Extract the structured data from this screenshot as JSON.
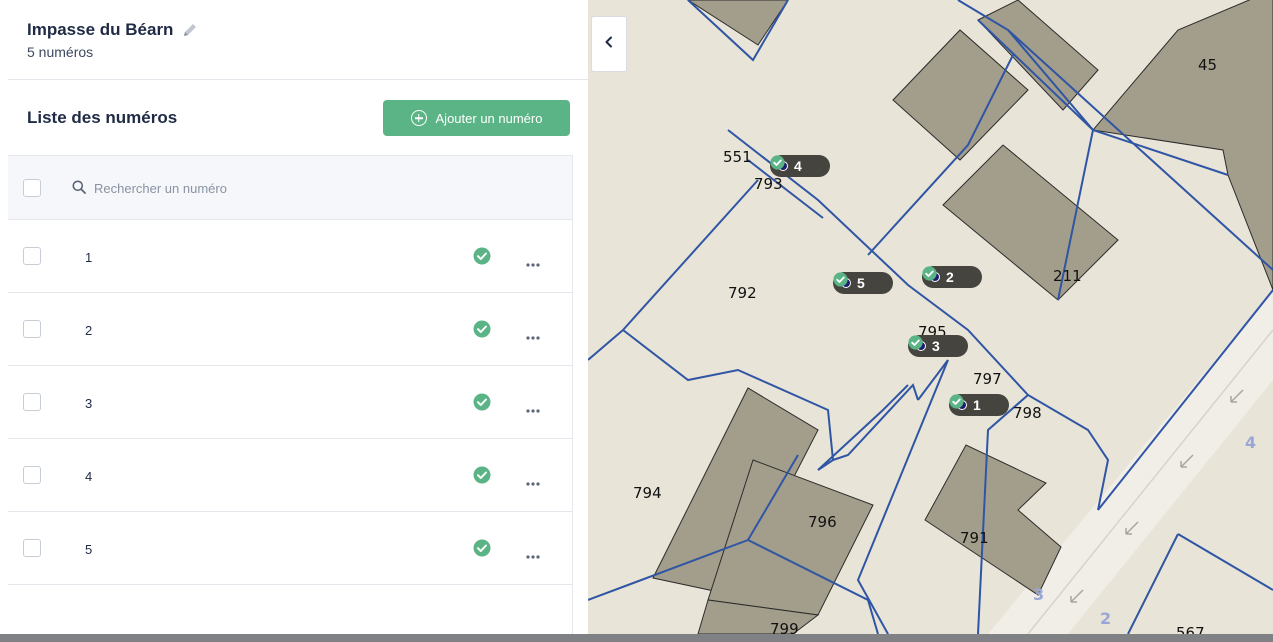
{
  "header": {
    "street_name": "Impasse du Béarn",
    "count_label": "5 numéros"
  },
  "list": {
    "title": "Liste des numéros",
    "add_button_label": "Ajouter un numéro",
    "search_placeholder": "Rechercher un numéro",
    "rows": [
      {
        "number": "1",
        "certified": true
      },
      {
        "number": "2",
        "certified": true
      },
      {
        "number": "3",
        "certified": true
      },
      {
        "number": "4",
        "certified": true
      },
      {
        "number": "5",
        "certified": true
      }
    ]
  },
  "map": {
    "parcel_labels": [
      "551",
      "793",
      "792",
      "795",
      "797",
      "798",
      "794",
      "796",
      "791",
      "799",
      "211",
      "45",
      "567"
    ],
    "street_number_labels": [
      "3",
      "2",
      "4"
    ],
    "markers": [
      {
        "label": "4"
      },
      {
        "label": "5"
      },
      {
        "label": "2"
      },
      {
        "label": "3"
      },
      {
        "label": "1"
      }
    ]
  },
  "colors": {
    "accent_green": "#5bb486",
    "parcel_line": "#2f55a4",
    "building_fill": "#a39e8b",
    "marker_bg": "#45443f"
  },
  "icons": {
    "edit": "pencil-icon",
    "add": "plus-circle-icon",
    "search": "search-icon",
    "certified": "check-circle-icon",
    "more": "more-horizontal-icon",
    "collapse": "chevron-left-icon"
  }
}
